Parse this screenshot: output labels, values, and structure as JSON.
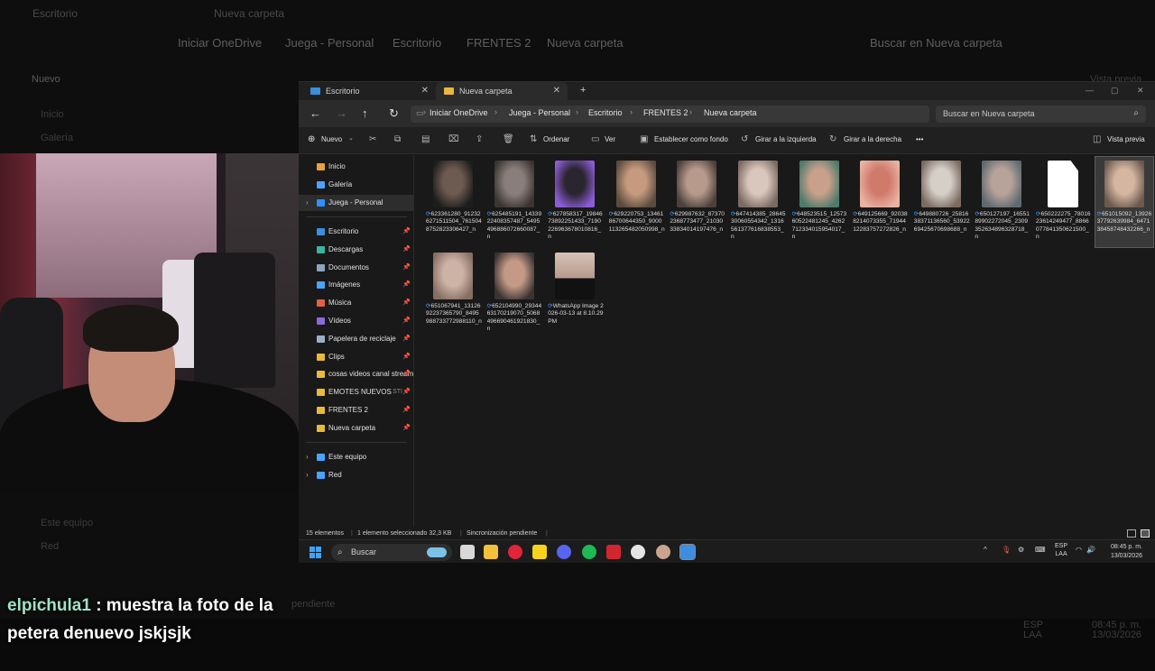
{
  "background_window": {
    "tabs": [
      "Escritorio",
      "Nueva carpeta"
    ],
    "breadcrumb": [
      "Iniciar OneDrive",
      "Juega - Personal",
      "Escritorio",
      "FRENTES 2",
      "Nueva carpeta"
    ],
    "search_placeholder": "Buscar en Nueva carpeta",
    "toolbar": [
      "Nuevo",
      "Ordenar",
      "Ver",
      "Establecer como fondo",
      "Girar a la izquierda",
      "Girar a la derecha",
      "Vista previa"
    ],
    "sidebar": [
      "Inicio",
      "Galería",
      "Este equipo",
      "Red"
    ],
    "status_fragment": "pendiente"
  },
  "explorer": {
    "tabs": [
      {
        "label": "Escritorio",
        "icon": "desktop-folder-icon"
      },
      {
        "label": "Nueva carpeta",
        "icon": "folder-icon"
      }
    ],
    "new_tab": "+",
    "window_controls": [
      "—",
      "▢",
      "✕"
    ],
    "nav": {
      "back": "←",
      "forward": "→",
      "up": "↑",
      "refresh": "↻"
    },
    "breadcrumb": [
      "Iniciar OneDrive",
      "Juega - Personal",
      "Escritorio",
      "FRENTES 2",
      "Nueva carpeta"
    ],
    "search_placeholder": "Buscar en Nueva carpeta",
    "toolbar": {
      "new": "Nuevo",
      "sort": "Ordenar",
      "view": "Ver",
      "set_background": "Establecer como fondo",
      "rotate_left": "Girar a la izquierda",
      "rotate_right": "Girar a la derecha",
      "more": "•••",
      "preview": "Vista previa"
    },
    "sidebar": {
      "top": [
        {
          "label": "Inicio",
          "icon": "home-icon",
          "color": "#e9a040"
        },
        {
          "label": "Galería",
          "icon": "gallery-icon",
          "color": "#4aa3ff"
        },
        {
          "label": "Juega - Personal",
          "icon": "onedrive-icon",
          "color": "#2f8fff"
        }
      ],
      "quick_access": [
        {
          "label": "Escritorio",
          "icon": "desktop-icon",
          "color": "#3a8fd9",
          "pinned": true
        },
        {
          "label": "Descargas",
          "icon": "download-icon",
          "color": "#3cb4a0",
          "pinned": true
        },
        {
          "label": "Documentos",
          "icon": "documents-icon",
          "color": "#8aa4c4",
          "pinned": true
        },
        {
          "label": "Imágenes",
          "icon": "pictures-icon",
          "color": "#4aa3ff",
          "pinned": true
        },
        {
          "label": "Música",
          "icon": "music-icon",
          "color": "#e0604a",
          "pinned": true
        },
        {
          "label": "Vídeos",
          "icon": "videos-icon",
          "color": "#8a6ad9",
          "pinned": true
        },
        {
          "label": "Papelera de reciclaje",
          "icon": "recycle-bin-icon",
          "color": "#9ab0c8",
          "pinned": true
        },
        {
          "label": "Clips",
          "icon": "folder-icon",
          "color": "#e8b93c",
          "pinned": true
        },
        {
          "label": "cosas videos canal stream",
          "icon": "folder-icon",
          "color": "#e8b93c",
          "pinned": true
        },
        {
          "label": "EMOTES NUEVOS",
          "icon": "folder-icon",
          "color": "#e8b93c",
          "pinned": true,
          "suffix": "STI"
        },
        {
          "label": "FRENTES 2",
          "icon": "folder-icon",
          "color": "#e8b93c",
          "pinned": true
        },
        {
          "label": "Nueva carpeta",
          "icon": "folder-icon",
          "color": "#e8b93c",
          "pinned": true
        }
      ],
      "bottom": [
        {
          "label": "Este equipo",
          "icon": "this-pc-icon",
          "color": "#4aa3ff"
        },
        {
          "label": "Red",
          "icon": "network-icon",
          "color": "#4aa3ff"
        }
      ]
    },
    "files": [
      {
        "name": "623361280_912326271511504_7615048752823306427_n",
        "thumb": [
          "#6d5a50",
          "#1d1d1d"
        ]
      },
      {
        "name": "625485191_1433922408357487_5495496886072660087_n",
        "thumb": [
          "#8a7e7a",
          "#3b3432"
        ]
      },
      {
        "name": "627858317_1984673892251433_7190226963678010816_n",
        "thumb": [
          "#2b2530",
          "#8b5cd6"
        ]
      },
      {
        "name": "629220753_1346186700644350_9000113265482050998_n",
        "thumb": [
          "#c59a7e",
          "#5b4a3e"
        ]
      },
      {
        "name": "629987632_873702368773477_2103033834014197476_n",
        "thumb": [
          "#b89a8c",
          "#4b403b"
        ]
      },
      {
        "name": "647414385_2864530060554342_1316561377616838553_n",
        "thumb": [
          "#d9c6bd",
          "#7a6a62"
        ]
      },
      {
        "name": "648523515_1257360522481245_4262712334015954017_n",
        "thumb": [
          "#c8a08b",
          "#4f7a6a"
        ]
      },
      {
        "name": "649125669_920388214073355_7194412283757272826_n",
        "thumb": [
          "#d07a6c",
          "#e9b3a2"
        ]
      },
      {
        "name": "649880726_2581638371136560_5392269425670698688_n",
        "thumb": [
          "#d6cfc8",
          "#7b6b61"
        ]
      },
      {
        "name": "650127197_1655189902272045_2309352634896328718_n",
        "thumb": [
          "#b8a39a",
          "#5f6a70"
        ]
      },
      {
        "name": "650222275_7801623614249477_8866077841350621500_n",
        "thumb": [
          "#ffffff",
          "#e9e9e9"
        ]
      },
      {
        "name": "651015092_1392637792639984_647138458748432266_n",
        "thumb": [
          "#d5b6a0",
          "#6c5a4f"
        ],
        "selected": true
      },
      {
        "name": "651067941_1312692237365790_8495988733772988110_n",
        "thumb": [
          "#ccb3a6",
          "#866e62"
        ]
      },
      {
        "name": "652104990_2934463170219070_5068496690461921830_n",
        "thumb": [
          "#c49a86",
          "#3a3233"
        ]
      },
      {
        "name": "WhatsApp Image 2026-03-13 at 8.10.29 PM",
        "thumb": [
          "#d7c2b8",
          "#111111"
        ],
        "whatsapp": true
      }
    ],
    "status": {
      "count": "15 elementos",
      "selection": "1 elemento seleccionado  32,3 KB",
      "sync": "Sincronización pendiente"
    }
  },
  "taskbar": {
    "search": "Buscar",
    "apps": [
      {
        "name": "task-view-icon",
        "color": "#d8d8d8"
      },
      {
        "name": "file-explorer-icon",
        "color": "#f3c13a"
      },
      {
        "name": "opera-gx-icon",
        "color": "#e0243a"
      },
      {
        "name": "sticky-notes-icon",
        "color": "#f6d21a"
      },
      {
        "name": "discord-icon",
        "color": "#5865f2"
      },
      {
        "name": "spotify-icon",
        "color": "#1db954"
      },
      {
        "name": "obs-icon",
        "color": "#d2262f"
      },
      {
        "name": "github-icon",
        "color": "#e5e5e5"
      },
      {
        "name": "avatar-app-icon",
        "color": "#c9a48f"
      },
      {
        "name": "paint-app-icon",
        "color": "#3d8de0"
      }
    ],
    "tray": {
      "chevron": "^",
      "lang1": "ESP",
      "lang2": "LAA",
      "time": "08:45 p. m.",
      "date": "13/03/2026"
    }
  },
  "chat": {
    "user": "elpichula1",
    "message": " : muestra la foto de la petera denuevo jskjsjk"
  }
}
